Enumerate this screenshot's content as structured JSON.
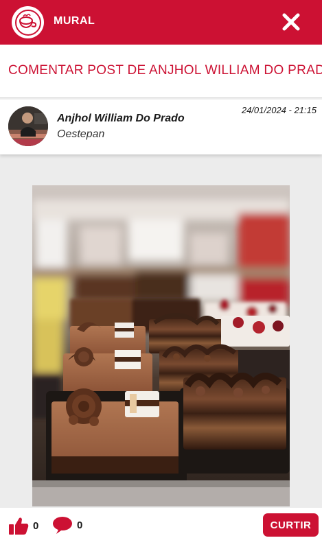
{
  "colors": {
    "brand": "#cc1133",
    "background": "#ececec",
    "surface": "#ffffff"
  },
  "topbar": {
    "title": "MURAL",
    "logo_icon": "cake-cup-icon",
    "close_icon": "close-icon"
  },
  "page": {
    "heading": "COMENTAR POST DE ANJHOL WILLIAM DO PRADO"
  },
  "post": {
    "author_name": "Anjhol William Do Prado",
    "author_company": "Oestepan",
    "date": "24/01/2024 - 21:15",
    "avatar_icon": "avatar",
    "image_icon": "chocolate-cakes-photo"
  },
  "footer": {
    "like_icon": "thumbs-up-icon",
    "likes_count": "0",
    "comment_icon": "speech-bubble-icon",
    "comments_count": "0",
    "curtir_label": "CURTIR"
  }
}
